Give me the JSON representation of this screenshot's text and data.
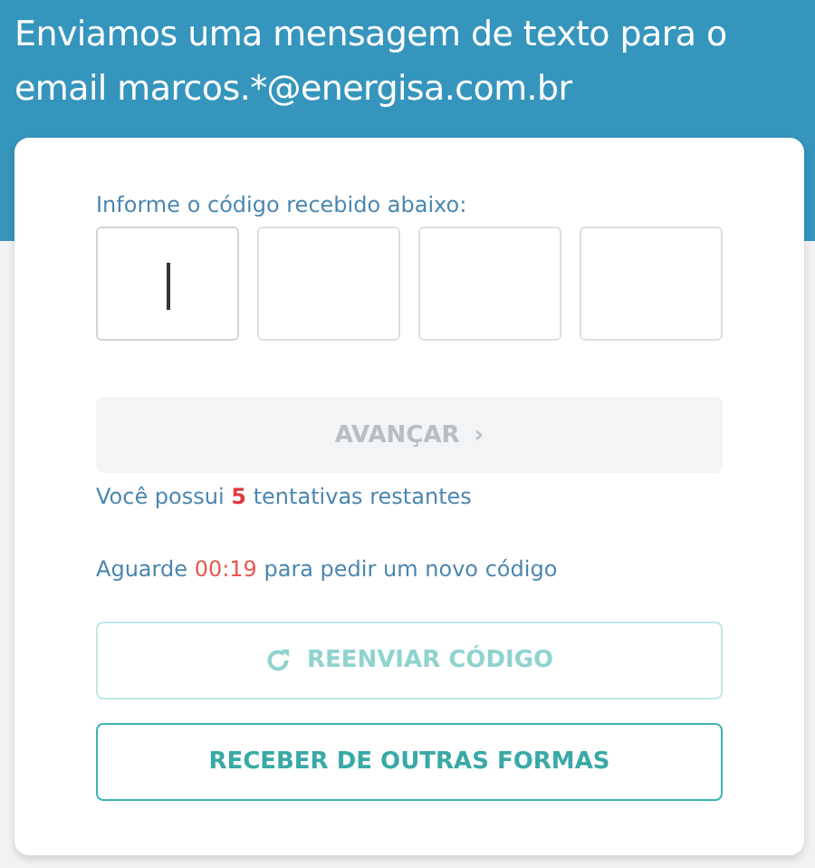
{
  "header": {
    "title": "Enviamos uma mensagem de texto para o email marcos.*@energisa.com.br"
  },
  "code_form": {
    "label": "Informe o código recebido abaixo:",
    "digits": [
      {
        "focused": true
      },
      {
        "focused": false
      },
      {
        "focused": false
      },
      {
        "focused": false
      }
    ],
    "advance_button": {
      "label": "AVANÇAR",
      "icon": "›",
      "disabled": true
    },
    "attempts": {
      "prefix": "Você possui",
      "count": "5",
      "suffix": "tentativas restantes"
    },
    "wait": {
      "prefix": "Aguarde",
      "time": "00:19",
      "suffix": "para pedir um novo código"
    },
    "resend_button": {
      "label": "REENVIAR CÓDIGO",
      "disabled": true
    },
    "other_button": {
      "label": "RECEBER DE OUTRAS FORMAS",
      "disabled": false
    }
  }
}
